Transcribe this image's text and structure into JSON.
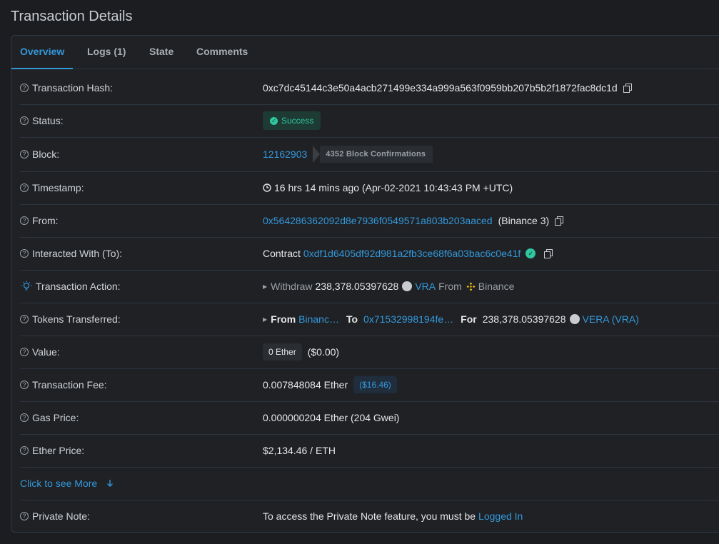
{
  "page": {
    "title": "Transaction Details"
  },
  "tabs": [
    {
      "label": "Overview"
    },
    {
      "label": "Logs (1)"
    },
    {
      "label": "State"
    },
    {
      "label": "Comments"
    }
  ],
  "rows": {
    "hash": {
      "label": "Transaction Hash:",
      "value": "0xc7dc45144c3e50a4acb271499e334a999a563f0959bb207b5b2f1872fac8dc1d"
    },
    "status": {
      "label": "Status:",
      "value": "Success"
    },
    "block": {
      "label": "Block:",
      "number": "12162903",
      "confirmations": "4352 Block Confirmations"
    },
    "timestamp": {
      "label": "Timestamp:",
      "value": "16 hrs 14 mins ago (Apr-02-2021 10:43:43 PM +UTC)"
    },
    "from": {
      "label": "From:",
      "address": "0x564286362092d8e7936f0549571a803b203aaced",
      "name": "(Binance 3)"
    },
    "interacted": {
      "label": "Interacted With (To):",
      "prefix": "Contract",
      "address": "0xdf1d6405df92d981a2fb3ce68f6a03bac6c0e41f"
    },
    "action": {
      "label": "Transaction Action:",
      "verb": "Withdraw",
      "amount": "238,378.05397628",
      "token": "VRA",
      "from_word": "From",
      "source": "Binance"
    },
    "tokens": {
      "label": "Tokens Transferred:",
      "from_word": "From",
      "from_value": "Binanc…",
      "to_word": "To",
      "to_value": "0x71532998194fe…",
      "for_word": "For",
      "amount": "238,378.05397628",
      "token": "VERA (VRA)"
    },
    "value": {
      "label": "Value:",
      "ether": "0 Ether",
      "usd": "($0.00)"
    },
    "fee": {
      "label": "Transaction Fee:",
      "ether": "0.007848084 Ether",
      "usd": "($16.46)"
    },
    "gas": {
      "label": "Gas Price:",
      "value": "0.000000204 Ether (204 Gwei)"
    },
    "ether_price": {
      "label": "Ether Price:",
      "value": "$2,134.46 / ETH"
    },
    "more": {
      "label": "Click to see More"
    },
    "note": {
      "label": "Private Note:",
      "text": "To access the Private Note feature, you must be",
      "link": "Logged In"
    }
  },
  "colors": {
    "accent": "#3498db",
    "success": "#2ec7a0",
    "background": "#1b1d20"
  }
}
